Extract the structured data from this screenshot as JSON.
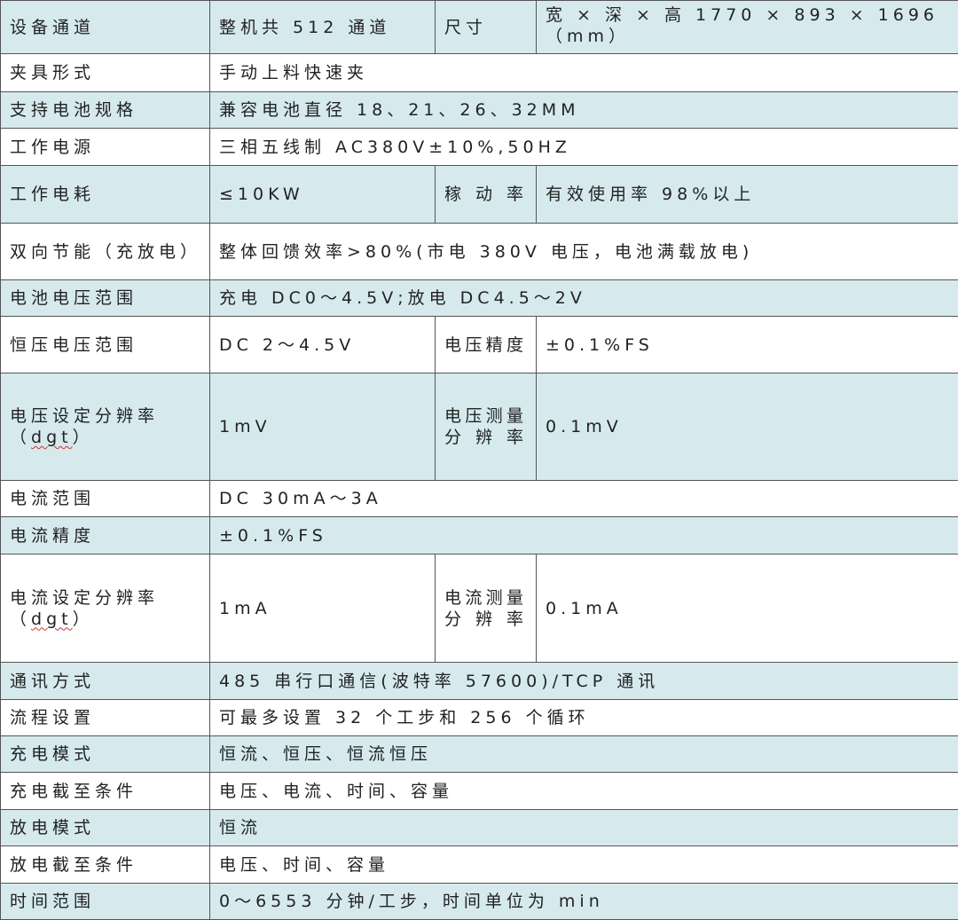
{
  "rows": [
    {
      "label": "设备通道",
      "value": "整机共 512 通道",
      "sub_label": "尺寸",
      "sub_value": "宽 × 深 × 高 1770 × 893 × 1696 （mm）"
    },
    {
      "label": "夹具形式",
      "value": "手动上料快速夹"
    },
    {
      "label": "支持电池规格",
      "value": "兼容电池直径 18、21、26、32MM"
    },
    {
      "label": "工作电源",
      "value": "三相五线制 AC380V±10%,50HZ"
    },
    {
      "label": "工作电耗",
      "value": "≤10KW",
      "sub_label": "稼动率",
      "sub_value": "有效使用率 98%以上"
    },
    {
      "label": "双向节能（充放电）",
      "value": "整体回馈效率>80%(市电 380V 电压，电池满载放电)"
    },
    {
      "label": "电池电压范围",
      "value": "充电 DC0～4.5V;放电 DC4.5～2V"
    },
    {
      "label": "恒压电压范围",
      "value": "DC 2～4.5V",
      "sub_label": "电压精度",
      "sub_value": "±0.1%FS"
    },
    {
      "label": "电压设定分辨率",
      "label_extra": "dgt",
      "value": "1mV",
      "sub_label": "电压测量分辨率",
      "sub_value": "0.1mV"
    },
    {
      "label": "电流范围",
      "value": "DC 30mA～3A"
    },
    {
      "label": "电流精度",
      "value": "±0.1%FS"
    },
    {
      "label": "电流设定分辨率",
      "label_extra": "dgt",
      "value": "1mA",
      "sub_label": "电流测量分辨率",
      "sub_value": "0.1mA"
    },
    {
      "label": "通讯方式",
      "value": "485 串行口通信(波特率 57600)/TCP 通讯"
    },
    {
      "label": "流程设置",
      "value": "可最多设置 32 个工步和 256 个循环"
    },
    {
      "label": "充电模式",
      "value": "恒流、恒压、恒流恒压"
    },
    {
      "label": "充电截至条件",
      "value": "电压、电流、时间、容量"
    },
    {
      "label": "放电模式",
      "value": "恒流"
    },
    {
      "label": "放电截至条件",
      "value": "电压、时间、容量"
    },
    {
      "label": "时间范围",
      "value": "0～6553 分钟/工步，时间单位为 min"
    }
  ]
}
